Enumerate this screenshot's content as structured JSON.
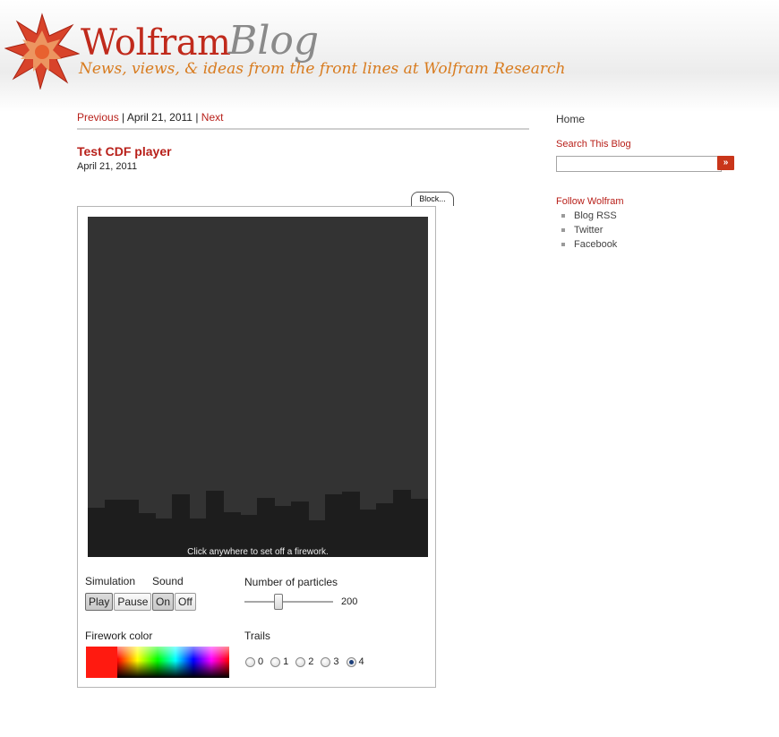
{
  "header": {
    "brand_word": "Wolfram",
    "brand_blog": "Blog",
    "tagline": "News, views, & ideas from the front lines at Wolfram Research"
  },
  "nav": {
    "previous": "Previous",
    "separator1": " | ",
    "date": "April 21, 2011",
    "separator2": " | ",
    "next": "Next"
  },
  "post": {
    "title": "Test CDF player",
    "date": "April 21, 2011"
  },
  "cdf": {
    "block_tab": "Block...",
    "canvas_hint": "Click anywhere to set off a firework.",
    "simulation": {
      "label": "Simulation",
      "options": [
        "Play",
        "Pause"
      ],
      "selected": "Play"
    },
    "sound": {
      "label": "Sound",
      "options": [
        "On",
        "Off"
      ],
      "selected": "On"
    },
    "particles": {
      "label": "Number of particles",
      "value": "200",
      "fraction": 0.35
    },
    "firework_color": {
      "label": "Firework color",
      "color": "#ff1a10"
    },
    "trails": {
      "label": "Trails",
      "options": [
        "0",
        "1",
        "2",
        "3",
        "4"
      ],
      "selected": "4"
    }
  },
  "sidebar": {
    "home": "Home",
    "search_heading": "Search This Blog",
    "search_placeholder": "",
    "search_button": "»",
    "follow_heading": "Follow Wolfram",
    "follow_links": [
      "Blog RSS",
      "Twitter",
      "Facebook"
    ]
  },
  "colors": {
    "accent_red": "#b8201a",
    "canvas_bg": "#333333",
    "skyline": "#1d1d1d"
  }
}
